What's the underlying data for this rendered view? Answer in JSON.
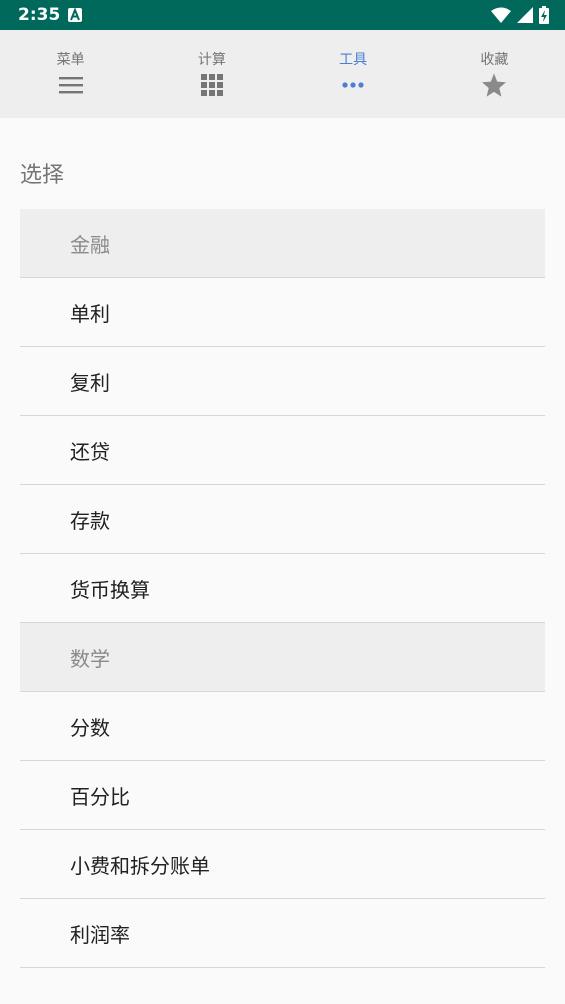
{
  "status_bar": {
    "time": "2:35",
    "notification_icon": "a-notification-icon",
    "icons": [
      "wifi-icon",
      "cell-signal-icon",
      "battery-charging-icon"
    ],
    "background": "#00695c"
  },
  "tabs": [
    {
      "label": "菜单",
      "icon": "menu-icon",
      "active": false
    },
    {
      "label": "计算",
      "icon": "grid-icon",
      "active": false
    },
    {
      "label": "工具",
      "icon": "more-dots-icon",
      "active": true
    },
    {
      "label": "收藏",
      "icon": "star-icon",
      "active": false
    }
  ],
  "accent_color": "#4a7fd6",
  "page": {
    "section_title": "选择"
  },
  "list": {
    "items": [
      {
        "label": "金融",
        "type": "header"
      },
      {
        "label": "单利",
        "type": "item"
      },
      {
        "label": "复利",
        "type": "item"
      },
      {
        "label": "还贷",
        "type": "item"
      },
      {
        "label": "存款",
        "type": "item"
      },
      {
        "label": "货币换算",
        "type": "item"
      },
      {
        "label": "数学",
        "type": "header"
      },
      {
        "label": "分数",
        "type": "item"
      },
      {
        "label": "百分比",
        "type": "item"
      },
      {
        "label": "小费和拆分账单",
        "type": "item"
      },
      {
        "label": "利润率",
        "type": "item"
      }
    ]
  }
}
